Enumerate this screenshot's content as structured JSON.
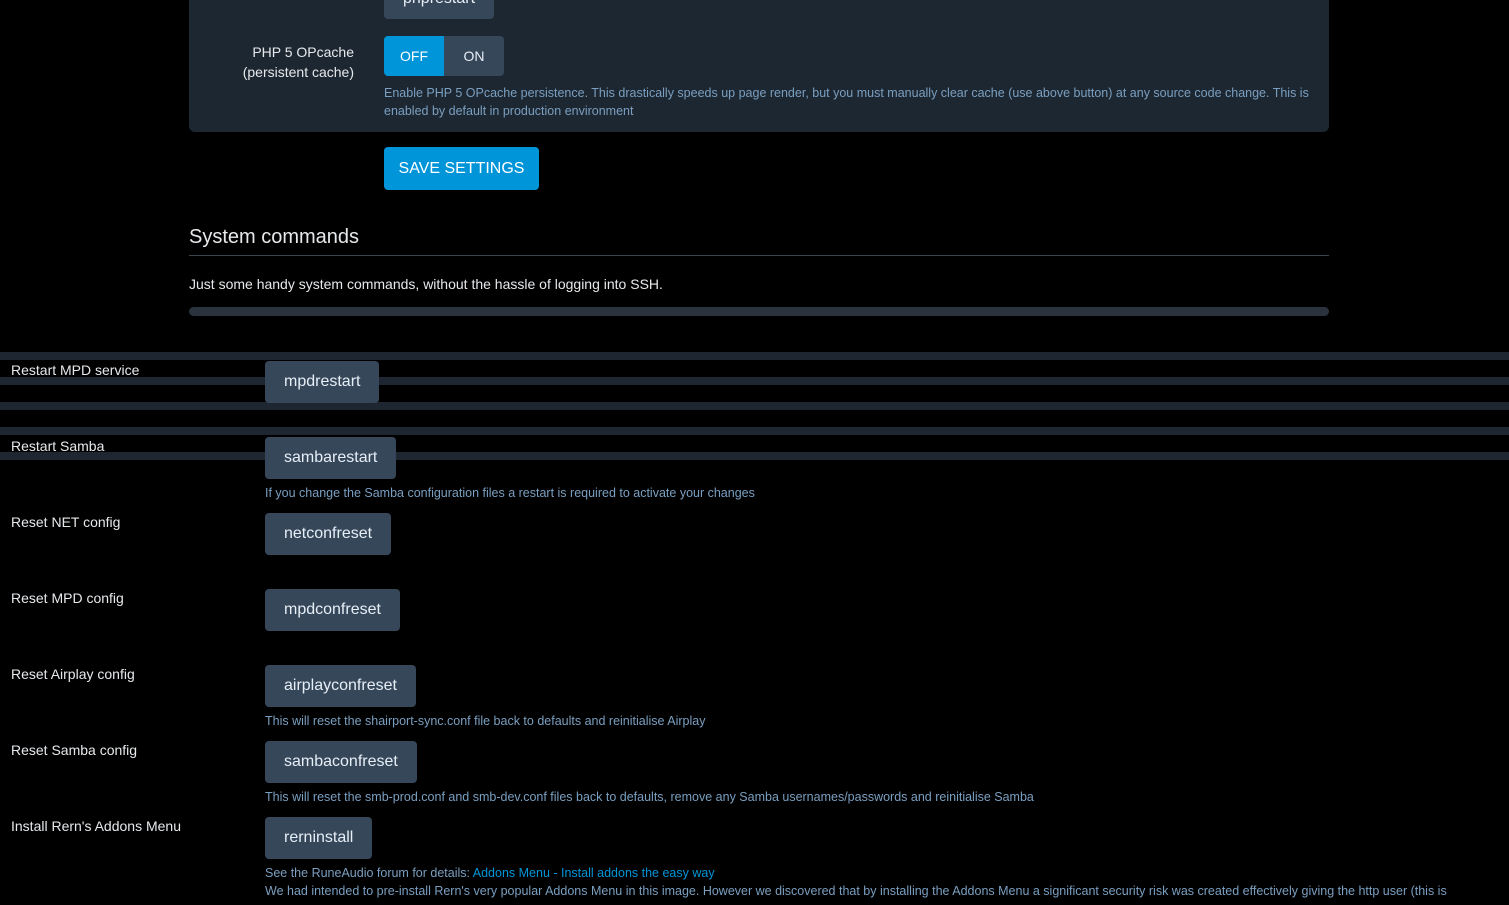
{
  "opcache": {
    "top_button": "phprestart",
    "label_line1": "PHP 5 OPcache",
    "label_line2": "(persistent cache)",
    "off": "OFF",
    "on": "ON",
    "help": "Enable PHP 5 OPcache persistence. This drastically speeds up page render, but you must manually clear cache (use above button) at any source code change. This is enabled by default in production environment"
  },
  "save_label": "SAVE SETTINGS",
  "system": {
    "title": "System commands",
    "intro": "Just some handy system commands, without the hassle of logging into SSH."
  },
  "commands": [
    {
      "label": "Restart MPD service",
      "button": "mpdrestart"
    },
    {
      "label": "Restart Samba",
      "button": "sambarestart",
      "help": "If you change the Samba configuration files a restart is required to activate your changes"
    },
    {
      "label": "Reset NET config",
      "button": "netconfreset"
    },
    {
      "label": "Reset MPD config",
      "button": "mpdconfreset"
    },
    {
      "label": "Reset Airplay config",
      "button": "airplayconfreset",
      "help": "This will reset the shairport-sync.conf file back to defaults and reinitialise Airplay"
    },
    {
      "label": "Reset Samba config",
      "button": "sambaconfreset",
      "help": "This will reset the smb-prod.conf and smb-dev.conf files back to defaults, remove any Samba usernames/passwords and reinitialise Samba"
    },
    {
      "label": "Install Rern's Addons Menu",
      "button": "rerninstall",
      "help_prefix": "See the RuneAudio forum for details: ",
      "help_link": "Addons Menu - Install addons the easy way",
      "help2": "We had intended to pre-install Rern's very popular Addons Menu in this image. However we discovered that by installing the Addons Menu a significant security risk was created effectively giving the http user (this is"
    }
  ]
}
